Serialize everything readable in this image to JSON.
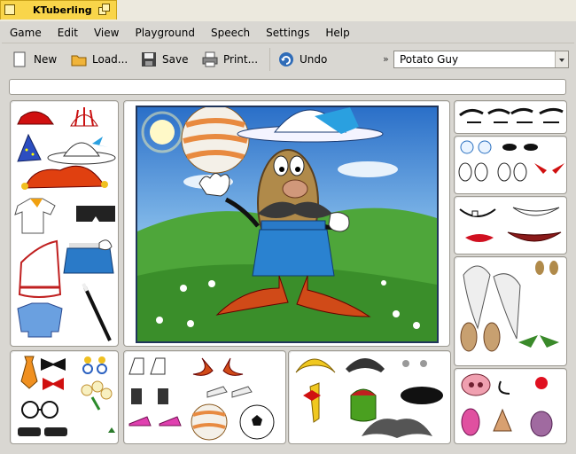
{
  "window": {
    "title": "KTuberling"
  },
  "menu": [
    "Game",
    "Edit",
    "View",
    "Playground",
    "Speech",
    "Settings",
    "Help"
  ],
  "toolbar": {
    "new_label": "New",
    "load_label": "Load...",
    "save_label": "Save",
    "print_label": "Print...",
    "undo_label": "Undo",
    "overflow": "»"
  },
  "playground_select": {
    "value": "Potato Guy"
  },
  "status": {
    "text": ""
  },
  "colors": {
    "accent": "#f9d54a",
    "scene_border": "#20355a",
    "sky": "#4a8fd6",
    "grass": "#3f9a2a"
  },
  "icons": [
    "new-document-icon",
    "folder-open-icon",
    "floppy-save-icon",
    "printer-icon",
    "undo-icon"
  ]
}
